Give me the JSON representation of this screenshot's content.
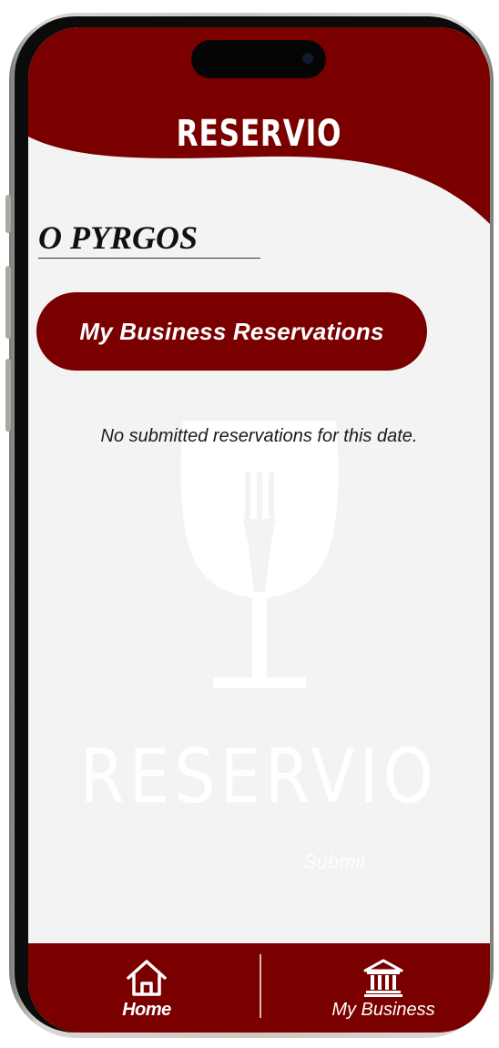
{
  "app": {
    "title": "RESERVIO"
  },
  "business": {
    "name": "O PYRGOS"
  },
  "main": {
    "reservations_button": "My Business Reservations",
    "empty_message": "No submitted reservations for this date.",
    "watermark_text": "RESERVIO",
    "submit_label": "Submit"
  },
  "nav": {
    "items": [
      {
        "label": "Home",
        "icon": "home-icon",
        "active": true
      },
      {
        "label": "My Business",
        "icon": "bank-icon",
        "active": false
      }
    ]
  },
  "colors": {
    "brand": "#7a0000",
    "background": "#f3f3f4"
  }
}
